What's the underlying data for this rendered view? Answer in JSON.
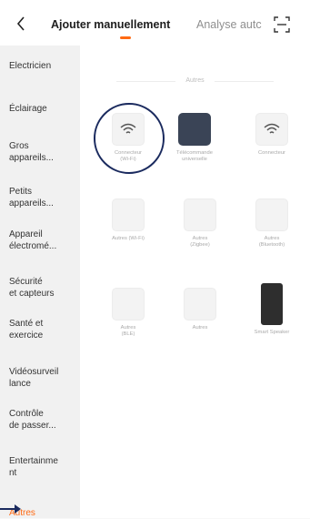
{
  "header": {
    "tabs": [
      {
        "label": "Ajouter manuellement",
        "active": true
      },
      {
        "label": "Analyse autc",
        "active": false
      }
    ],
    "icons": {
      "back": "chevron-left-icon",
      "scan": "scan-icon"
    }
  },
  "sidebar": {
    "items": [
      {
        "label": "Electricien"
      },
      {
        "label": "Éclairage"
      },
      {
        "label": "Gros\nappareils..."
      },
      {
        "label": "Petits\nappareils..."
      },
      {
        "label": "Appareil\nélectromé..."
      },
      {
        "label": "Sécurité\net capteurs"
      },
      {
        "label": "Santé et\nexercice"
      },
      {
        "label": "Vidéosurveil\nlance"
      },
      {
        "label": "Contrôle\nde passer..."
      },
      {
        "label": "Entertainme\nnt"
      },
      {
        "label": "Autres",
        "active": true
      }
    ]
  },
  "main": {
    "section_title": "Autres",
    "devices": [
      {
        "label": "Connecteur\n(Wi-Fi)",
        "icon": "wifi-icon"
      },
      {
        "label": "Télécommande\nuniverselle",
        "icon": "remote-hub-icon"
      },
      {
        "label": "Connecteur",
        "icon": "wifi-icon"
      },
      {
        "label": "Autres (Wi-Fi)",
        "icon": "device-icon"
      },
      {
        "label": "Autres\n(Zigbee)",
        "icon": "device-icon"
      },
      {
        "label": "Autres\n(Bluetooth)",
        "icon": "device-icon"
      },
      {
        "label": "Autres\n(BLE)",
        "icon": "device-icon"
      },
      {
        "label": "Autres",
        "icon": "device-icon"
      },
      {
        "label": "Smart Speaker",
        "icon": "speaker-icon"
      }
    ]
  },
  "colors": {
    "accent": "#ff6a13",
    "annotation": "#1a2a5e"
  }
}
